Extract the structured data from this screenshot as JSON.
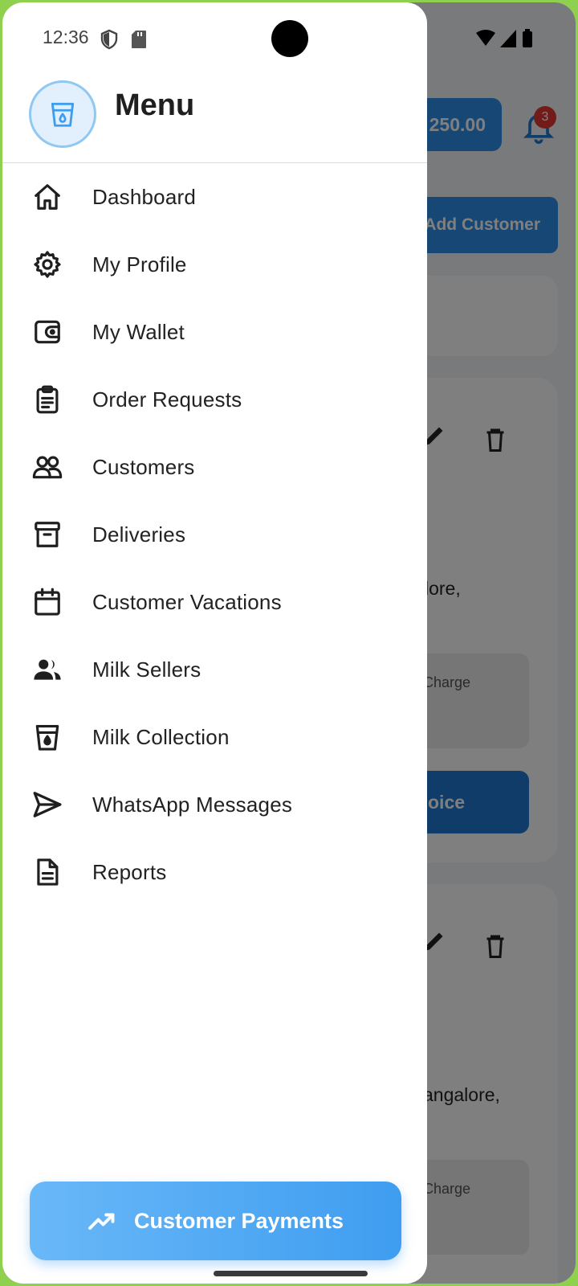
{
  "status_bar": {
    "time": "12:36",
    "icons": [
      "shield-icon",
      "sd-card-icon",
      "wifi-icon",
      "cellular-icon",
      "battery-icon"
    ]
  },
  "drawer": {
    "header": {
      "logo_icon": "milk-cup-icon",
      "title": "Menu"
    },
    "items": [
      {
        "label": "Dashboard",
        "icon": "home-icon"
      },
      {
        "label": "My Profile",
        "icon": "gear-icon"
      },
      {
        "label": "My Wallet",
        "icon": "wallet-icon"
      },
      {
        "label": "Order Requests",
        "icon": "clipboard-icon"
      },
      {
        "label": "Customers",
        "icon": "users-icon"
      },
      {
        "label": "Deliveries",
        "icon": "archive-box-icon"
      },
      {
        "label": "Customer Vacations",
        "icon": "calendar-icon"
      },
      {
        "label": "Milk Sellers",
        "icon": "people-icon"
      },
      {
        "label": "Milk Collection",
        "icon": "milk-cup-icon"
      },
      {
        "label": "WhatsApp Messages",
        "icon": "send-icon"
      },
      {
        "label": "Reports",
        "icon": "document-icon"
      }
    ],
    "cta": {
      "label": "Customer Payments",
      "icon": "trending-up-icon"
    }
  },
  "background": {
    "balance_partial": "250.00",
    "notification_count": "3",
    "add_button_partial": "Add Customer",
    "card1": {
      "address_partial": "lore,",
      "charge_partial": "Charge",
      "invoice_partial": "oice"
    },
    "card2": {
      "address_partial": "angalore,",
      "charge_partial": "Charge"
    }
  },
  "colors": {
    "accent": "#3f9df0",
    "accent_light": "#69b8f8",
    "logo_bg": "#e2f0fd",
    "badge": "#e53935"
  }
}
